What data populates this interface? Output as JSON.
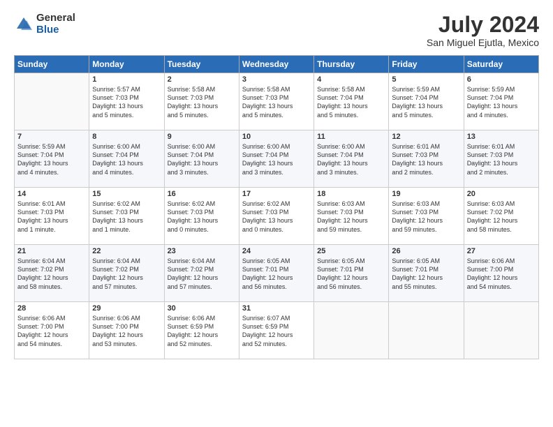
{
  "header": {
    "logo_general": "General",
    "logo_blue": "Blue",
    "title": "July 2024",
    "location": "San Miguel Ejutla, Mexico"
  },
  "days_of_week": [
    "Sunday",
    "Monday",
    "Tuesday",
    "Wednesday",
    "Thursday",
    "Friday",
    "Saturday"
  ],
  "weeks": [
    [
      {
        "num": "",
        "info": ""
      },
      {
        "num": "1",
        "info": "Sunrise: 5:57 AM\nSunset: 7:03 PM\nDaylight: 13 hours\nand 5 minutes."
      },
      {
        "num": "2",
        "info": "Sunrise: 5:58 AM\nSunset: 7:03 PM\nDaylight: 13 hours\nand 5 minutes."
      },
      {
        "num": "3",
        "info": "Sunrise: 5:58 AM\nSunset: 7:03 PM\nDaylight: 13 hours\nand 5 minutes."
      },
      {
        "num": "4",
        "info": "Sunrise: 5:58 AM\nSunset: 7:04 PM\nDaylight: 13 hours\nand 5 minutes."
      },
      {
        "num": "5",
        "info": "Sunrise: 5:59 AM\nSunset: 7:04 PM\nDaylight: 13 hours\nand 5 minutes."
      },
      {
        "num": "6",
        "info": "Sunrise: 5:59 AM\nSunset: 7:04 PM\nDaylight: 13 hours\nand 4 minutes."
      }
    ],
    [
      {
        "num": "7",
        "info": "Sunrise: 5:59 AM\nSunset: 7:04 PM\nDaylight: 13 hours\nand 4 minutes."
      },
      {
        "num": "8",
        "info": "Sunrise: 6:00 AM\nSunset: 7:04 PM\nDaylight: 13 hours\nand 4 minutes."
      },
      {
        "num": "9",
        "info": "Sunrise: 6:00 AM\nSunset: 7:04 PM\nDaylight: 13 hours\nand 3 minutes."
      },
      {
        "num": "10",
        "info": "Sunrise: 6:00 AM\nSunset: 7:04 PM\nDaylight: 13 hours\nand 3 minutes."
      },
      {
        "num": "11",
        "info": "Sunrise: 6:00 AM\nSunset: 7:04 PM\nDaylight: 13 hours\nand 3 minutes."
      },
      {
        "num": "12",
        "info": "Sunrise: 6:01 AM\nSunset: 7:03 PM\nDaylight: 13 hours\nand 2 minutes."
      },
      {
        "num": "13",
        "info": "Sunrise: 6:01 AM\nSunset: 7:03 PM\nDaylight: 13 hours\nand 2 minutes."
      }
    ],
    [
      {
        "num": "14",
        "info": "Sunrise: 6:01 AM\nSunset: 7:03 PM\nDaylight: 13 hours\nand 1 minute."
      },
      {
        "num": "15",
        "info": "Sunrise: 6:02 AM\nSunset: 7:03 PM\nDaylight: 13 hours\nand 1 minute."
      },
      {
        "num": "16",
        "info": "Sunrise: 6:02 AM\nSunset: 7:03 PM\nDaylight: 13 hours\nand 0 minutes."
      },
      {
        "num": "17",
        "info": "Sunrise: 6:02 AM\nSunset: 7:03 PM\nDaylight: 13 hours\nand 0 minutes."
      },
      {
        "num": "18",
        "info": "Sunrise: 6:03 AM\nSunset: 7:03 PM\nDaylight: 12 hours\nand 59 minutes."
      },
      {
        "num": "19",
        "info": "Sunrise: 6:03 AM\nSunset: 7:03 PM\nDaylight: 12 hours\nand 59 minutes."
      },
      {
        "num": "20",
        "info": "Sunrise: 6:03 AM\nSunset: 7:02 PM\nDaylight: 12 hours\nand 58 minutes."
      }
    ],
    [
      {
        "num": "21",
        "info": "Sunrise: 6:04 AM\nSunset: 7:02 PM\nDaylight: 12 hours\nand 58 minutes."
      },
      {
        "num": "22",
        "info": "Sunrise: 6:04 AM\nSunset: 7:02 PM\nDaylight: 12 hours\nand 57 minutes."
      },
      {
        "num": "23",
        "info": "Sunrise: 6:04 AM\nSunset: 7:02 PM\nDaylight: 12 hours\nand 57 minutes."
      },
      {
        "num": "24",
        "info": "Sunrise: 6:05 AM\nSunset: 7:01 PM\nDaylight: 12 hours\nand 56 minutes."
      },
      {
        "num": "25",
        "info": "Sunrise: 6:05 AM\nSunset: 7:01 PM\nDaylight: 12 hours\nand 56 minutes."
      },
      {
        "num": "26",
        "info": "Sunrise: 6:05 AM\nSunset: 7:01 PM\nDaylight: 12 hours\nand 55 minutes."
      },
      {
        "num": "27",
        "info": "Sunrise: 6:06 AM\nSunset: 7:00 PM\nDaylight: 12 hours\nand 54 minutes."
      }
    ],
    [
      {
        "num": "28",
        "info": "Sunrise: 6:06 AM\nSunset: 7:00 PM\nDaylight: 12 hours\nand 54 minutes."
      },
      {
        "num": "29",
        "info": "Sunrise: 6:06 AM\nSunset: 7:00 PM\nDaylight: 12 hours\nand 53 minutes."
      },
      {
        "num": "30",
        "info": "Sunrise: 6:06 AM\nSunset: 6:59 PM\nDaylight: 12 hours\nand 52 minutes."
      },
      {
        "num": "31",
        "info": "Sunrise: 6:07 AM\nSunset: 6:59 PM\nDaylight: 12 hours\nand 52 minutes."
      },
      {
        "num": "",
        "info": ""
      },
      {
        "num": "",
        "info": ""
      },
      {
        "num": "",
        "info": ""
      }
    ]
  ]
}
